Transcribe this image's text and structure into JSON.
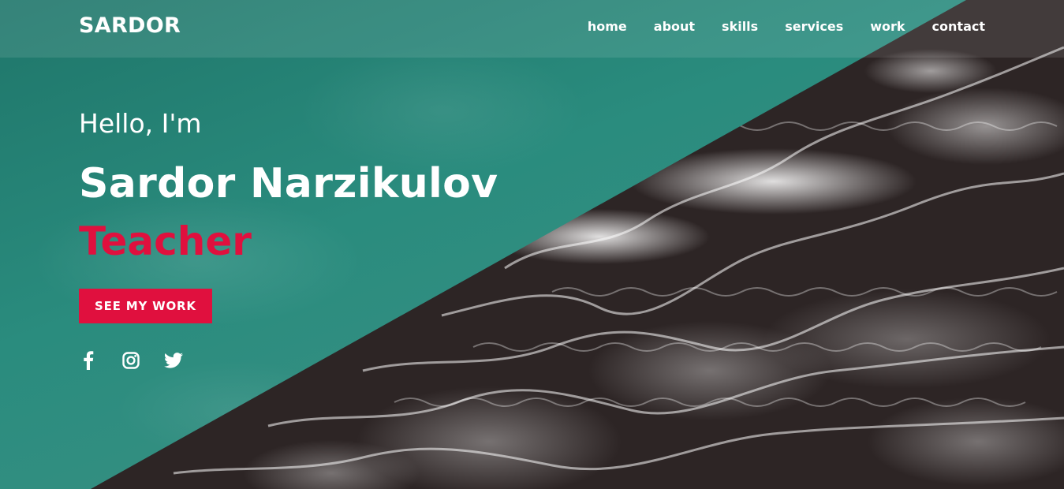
{
  "brand": {
    "logo": "SARDOR"
  },
  "nav": {
    "links": [
      {
        "label": "home"
      },
      {
        "label": "about"
      },
      {
        "label": "skills"
      },
      {
        "label": "services"
      },
      {
        "label": "work"
      },
      {
        "label": "contact"
      }
    ]
  },
  "hero": {
    "greeting": "Hello, I'm",
    "name": "Sardor Narzikulov",
    "role": "Teacher",
    "cta_label": "SEE MY WORK"
  },
  "socials": [
    {
      "icon": "facebook-icon"
    },
    {
      "icon": "instagram-icon"
    },
    {
      "icon": "twitter-icon"
    }
  ],
  "colors": {
    "accent": "#e0103e",
    "teal": "#2a8c7e",
    "text": "#ffffff"
  }
}
